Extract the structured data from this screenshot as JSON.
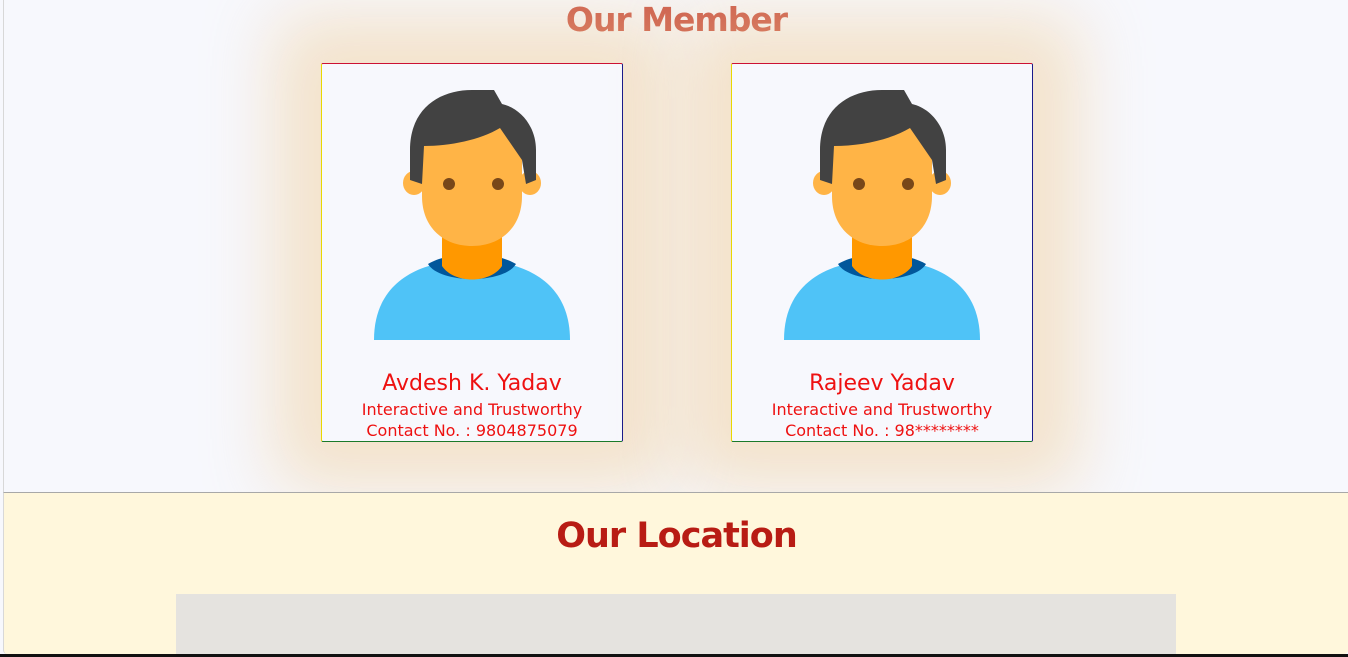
{
  "members_section": {
    "title": "Our Member",
    "members": [
      {
        "name": "Avdesh K. Yadav",
        "tagline": "Interactive and Trustworthy",
        "contact": "Contact No. : 9804875079",
        "avatar_icon": "male-user-avatar-icon"
      },
      {
        "name": "Rajeev Yadav",
        "tagline": "Interactive and Trustworthy",
        "contact": "Contact No. : 98********",
        "avatar_icon": "male-user-avatar-icon"
      }
    ]
  },
  "location_section": {
    "title": "Our Location"
  },
  "colors": {
    "member_title": "#cc5a4c",
    "location_title": "#b81c14",
    "card_text": "#ee1111",
    "location_bg": "#fff7dc",
    "map_bg": "#e5e3df",
    "avatar_skin": "#ffb446",
    "avatar_hair": "#424242",
    "avatar_shirt": "#4fc3f7",
    "avatar_collar": "#01579b",
    "avatar_neck": "#ff9800"
  }
}
